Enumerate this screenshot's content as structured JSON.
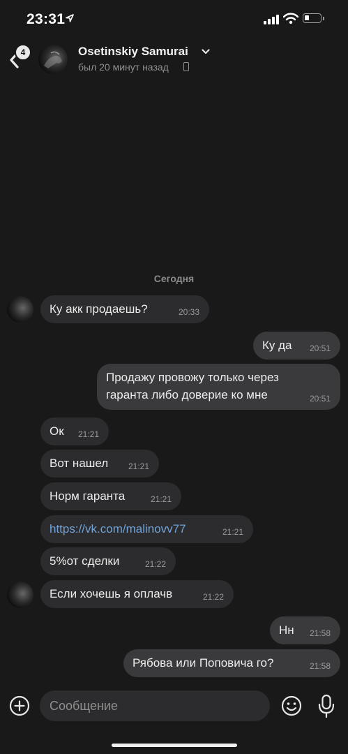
{
  "status_bar": {
    "time": "23:31",
    "battery_level": 0.3
  },
  "header": {
    "back_badge": "4",
    "name": "Osetinskiy Samurai",
    "status": "был 20 минут назад"
  },
  "date_separator": "Сегодня",
  "messages": [
    {
      "text": "Ку акк продаешь?",
      "time": "20:33",
      "direction": "incoming"
    },
    {
      "text": "Ку да",
      "time": "20:51",
      "direction": "outgoing"
    },
    {
      "text": "Продажу провожу только через гаранта либо доверие ко мне",
      "time": "20:51",
      "direction": "outgoing"
    },
    {
      "text": "Ок",
      "time": "21:21",
      "direction": "incoming"
    },
    {
      "text": "Вот нашел",
      "time": "21:21",
      "direction": "incoming"
    },
    {
      "text": "Норм гаранта",
      "time": "21:21",
      "direction": "incoming"
    },
    {
      "text": "https://vk.com/malinovv77",
      "time": "21:21",
      "direction": "incoming"
    },
    {
      "text": "5%от сделки",
      "time": "21:22",
      "direction": "incoming"
    },
    {
      "text": "Если хочешь я оплачв",
      "time": "21:22",
      "direction": "incoming"
    },
    {
      "text": "Нн",
      "time": "21:58",
      "direction": "outgoing"
    },
    {
      "text": "Рябова или Поповича го?",
      "time": "21:58",
      "direction": "outgoing"
    }
  ],
  "composer": {
    "placeholder": "Сообщение"
  },
  "colors": {
    "background": "#191919",
    "bubble_incoming": "#2c2c2e",
    "bubble_outgoing": "#3a3a3c",
    "link": "#6fa2d8"
  }
}
